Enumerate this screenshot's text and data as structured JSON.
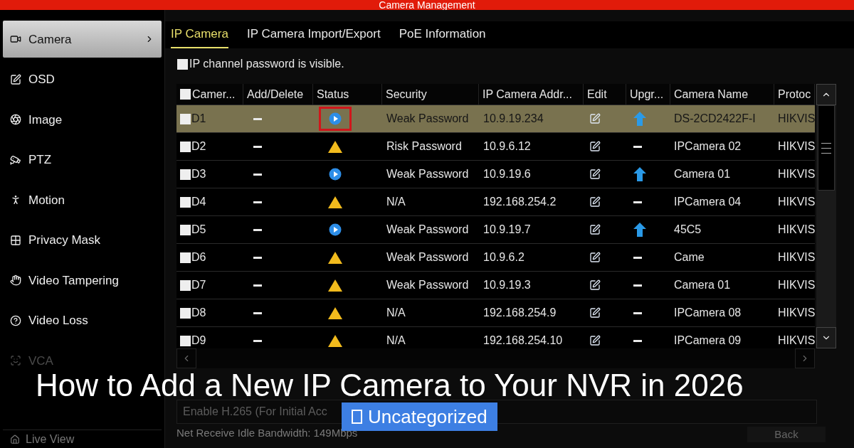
{
  "window": {
    "title": "Camera Management"
  },
  "sidebar": {
    "items": [
      {
        "label": "Camera",
        "selected": true
      },
      {
        "label": "OSD",
        "selected": false
      },
      {
        "label": "Image",
        "selected": false
      },
      {
        "label": "PTZ",
        "selected": false
      },
      {
        "label": "Motion",
        "selected": false
      },
      {
        "label": "Privacy Mask",
        "selected": false
      },
      {
        "label": "Video Tampering",
        "selected": false
      },
      {
        "label": "Video Loss",
        "selected": false
      },
      {
        "label": "VCA",
        "selected": false,
        "disabled": true
      }
    ],
    "footer": "Live View"
  },
  "tabs": [
    {
      "label": "IP Camera",
      "selected": true
    },
    {
      "label": "IP Camera Import/Export",
      "selected": false
    },
    {
      "label": "PoE Information",
      "selected": false
    }
  ],
  "password_visible": {
    "label": "IP channel password is visible.",
    "checked": false
  },
  "table": {
    "columns": [
      "Camer...",
      "Add/Delete",
      "Status",
      "Security",
      "IP Camera Addr...",
      "Edit",
      "Upgr...",
      "Camera Name",
      "Protoc"
    ],
    "select_all_checked": false,
    "rows": [
      {
        "channel": "D1",
        "checked": false,
        "selected": true,
        "kind": "online",
        "highlighted": true,
        "security": "Weak Password",
        "ip": "10.9.19.234",
        "upgrade": true,
        "name": "DS-2CD2422F-I",
        "protocol": "HIKVIS"
      },
      {
        "channel": "D2",
        "checked": false,
        "selected": false,
        "kind": "warning",
        "highlighted": false,
        "security": "Risk Password",
        "ip": "10.9.6.12",
        "upgrade": false,
        "name": "IPCamera 02",
        "protocol": "HIKVIS"
      },
      {
        "channel": "D3",
        "checked": false,
        "selected": false,
        "kind": "online",
        "highlighted": false,
        "security": "Weak Password",
        "ip": "10.9.19.6",
        "upgrade": true,
        "name": "Camera 01",
        "protocol": "HIKVIS"
      },
      {
        "channel": "D4",
        "checked": false,
        "selected": false,
        "kind": "warning",
        "highlighted": false,
        "security": "N/A",
        "ip": "192.168.254.2",
        "upgrade": false,
        "name": "IPCamera 04",
        "protocol": "HIKVIS"
      },
      {
        "channel": "D5",
        "checked": false,
        "selected": false,
        "kind": "online",
        "highlighted": false,
        "security": "Weak Password",
        "ip": "10.9.19.7",
        "upgrade": true,
        "name": "45C5",
        "protocol": "HIKVIS"
      },
      {
        "channel": "D6",
        "checked": false,
        "selected": false,
        "kind": "warning",
        "highlighted": false,
        "security": "Weak Password",
        "ip": "10.9.6.2",
        "upgrade": false,
        "name": "Came",
        "protocol": "HIKVIS"
      },
      {
        "channel": "D7",
        "checked": false,
        "selected": false,
        "kind": "warning",
        "highlighted": false,
        "security": "Weak Password",
        "ip": "10.9.19.3",
        "upgrade": false,
        "name": "Camera 01",
        "protocol": "HIKVIS"
      },
      {
        "channel": "D8",
        "checked": false,
        "selected": false,
        "kind": "warning",
        "highlighted": false,
        "security": "N/A",
        "ip": "192.168.254.9",
        "upgrade": false,
        "name": "IPCamera 08",
        "protocol": "HIKVIS"
      },
      {
        "channel": "D9",
        "checked": false,
        "selected": false,
        "kind": "warning",
        "highlighted": false,
        "security": "N/A",
        "ip": "192.168.254.10",
        "upgrade": false,
        "name": "IPCamera 09",
        "protocol": "HIKVIS"
      }
    ]
  },
  "h265_field": {
    "value": "Enable H.265 (For Initial Acc"
  },
  "bandwidth": "Net Receive Idle Bandwidth: 149Mbps",
  "back_button": "Back",
  "overlay": {
    "title": "How to Add a New IP Camera to Your NVR in 2026",
    "category": "Uncategorized"
  }
}
